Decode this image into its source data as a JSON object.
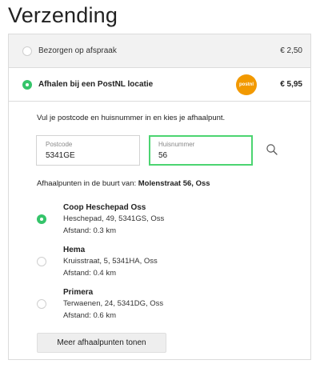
{
  "page": {
    "title": "Verzending"
  },
  "shipping_options": [
    {
      "label": "Bezorgen op afspraak",
      "price": "€ 2,50",
      "selected": false
    },
    {
      "label": "Afhalen bij een PostNL locatie",
      "price": "€ 5,95",
      "selected": true,
      "logo_text": "postnl"
    }
  ],
  "pickup_form": {
    "intro": "Vul je postcode en huisnummer in en kies je afhaalpunt.",
    "postcode": {
      "label": "Postcode",
      "value": "5341GE"
    },
    "huisnummer": {
      "label": "Huisnummer",
      "value": "56"
    },
    "near_prefix": "Afhaalpunten in de buurt van: ",
    "near_address": "Molenstraat 56, Oss"
  },
  "pickup_points": [
    {
      "name": "Coop Heschepad Oss",
      "address": "Heschepad, 49, 5341GS, Oss",
      "distance": "Afstand: 0.3 km",
      "selected": true
    },
    {
      "name": "Hema",
      "address": "Kruisstraat, 5, 5341HA, Oss",
      "distance": "Afstand: 0.4 km",
      "selected": false
    },
    {
      "name": "Primera",
      "address": "Terwaenen, 24, 5341DG, Oss",
      "distance": "Afstand: 0.6 km",
      "selected": false
    }
  ],
  "more_button": "Meer afhaalpunten tonen",
  "colors": {
    "accent_green": "#35c46a",
    "postnl_orange": "#f29900",
    "focus_border": "#4cd471"
  },
  "icons": {
    "search": "search-icon",
    "logo": "postnl-logo"
  }
}
